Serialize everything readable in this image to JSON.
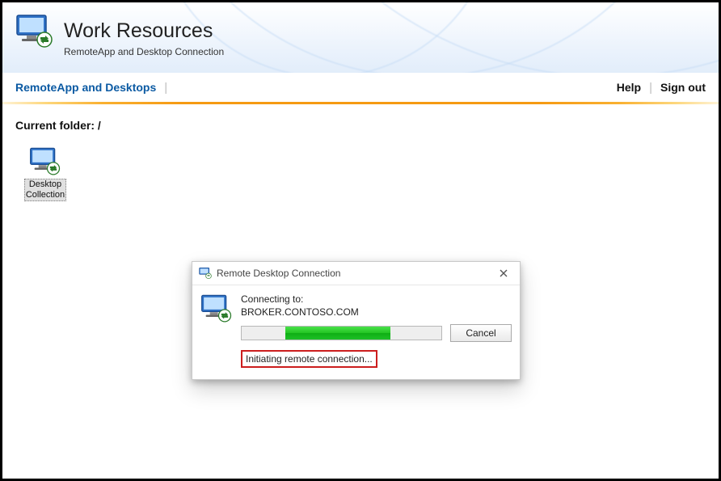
{
  "header": {
    "title": "Work Resources",
    "subtitle": "RemoteApp and Desktop Connection"
  },
  "nav": {
    "active_tab": "RemoteApp and Desktops",
    "help": "Help",
    "signout": "Sign out"
  },
  "content": {
    "current_folder_label": "Current folder: /",
    "items": [
      {
        "label": "Desktop\nCollection",
        "icon": "monitor-rdp-icon"
      }
    ]
  },
  "dialog": {
    "title": "Remote Desktop Connection",
    "connecting_label": "Connecting to:",
    "host": "BROKER.CONTOSO.COM",
    "status": "Initiating remote connection...",
    "cancel": "Cancel",
    "progress_percent": 45
  },
  "colors": {
    "link_blue": "#0b5aa3",
    "accent_orange": "#f59a13",
    "progress_green": "#1dc027",
    "highlight_red": "#cc1e1e"
  }
}
